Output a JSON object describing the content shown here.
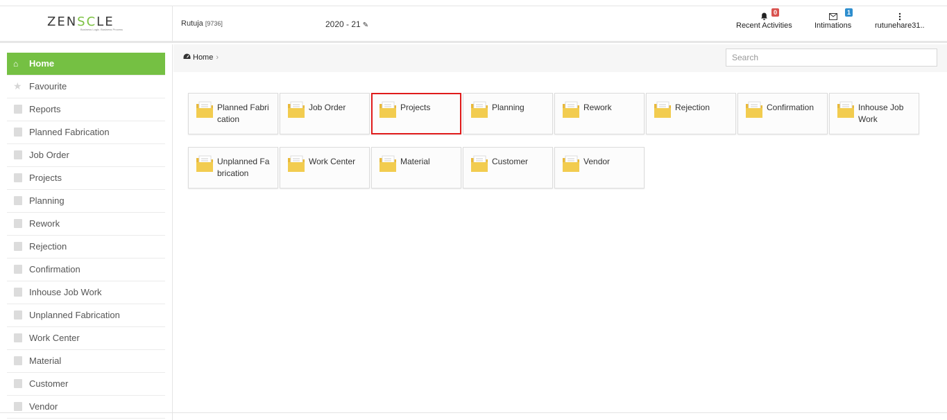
{
  "app": {
    "logo_prefix": "ZEN",
    "logo_highlight": "SC",
    "logo_suffix": "LE",
    "tagline": "Business Logic. Business Process"
  },
  "header": {
    "user_name": "Rutuja",
    "user_id": "[9736]",
    "year": "2020 - 21",
    "recent_activities": {
      "label": "Recent Activities",
      "count": "0"
    },
    "intimations": {
      "label": "Intimations",
      "count": "1"
    },
    "account": {
      "label": "rutunehare31.."
    }
  },
  "sidebar": {
    "items": [
      {
        "label": "Home",
        "icon": "home-icon"
      },
      {
        "label": "Favourite",
        "icon": "star-icon"
      },
      {
        "label": "Reports",
        "icon": "file-icon"
      },
      {
        "label": "Planned Fabrication",
        "icon": "file-icon"
      },
      {
        "label": "Job Order",
        "icon": "file-icon"
      },
      {
        "label": "Projects",
        "icon": "file-icon"
      },
      {
        "label": "Planning",
        "icon": "file-icon"
      },
      {
        "label": "Rework",
        "icon": "file-icon"
      },
      {
        "label": "Rejection",
        "icon": "file-icon"
      },
      {
        "label": "Confirmation",
        "icon": "file-icon"
      },
      {
        "label": "Inhouse Job Work",
        "icon": "file-icon"
      },
      {
        "label": "Unplanned Fabrication",
        "icon": "file-icon"
      },
      {
        "label": "Work Center",
        "icon": "file-icon"
      },
      {
        "label": "Material",
        "icon": "file-icon"
      },
      {
        "label": "Customer",
        "icon": "file-icon"
      },
      {
        "label": "Vendor",
        "icon": "file-icon"
      }
    ]
  },
  "breadcrumb": {
    "home": "Home",
    "separator": "›"
  },
  "search": {
    "placeholder": "Search",
    "value": ""
  },
  "tiles": [
    {
      "label": "Planned Fabri cation"
    },
    {
      "label": "Job Order"
    },
    {
      "label": "Projects"
    },
    {
      "label": "Planning"
    },
    {
      "label": "Rework"
    },
    {
      "label": "Rejection"
    },
    {
      "label": "Confirmation"
    },
    {
      "label": "Inhouse Job Work"
    },
    {
      "label": "Unplanned Fa brication"
    },
    {
      "label": "Work Center"
    },
    {
      "label": "Material"
    },
    {
      "label": "Customer"
    },
    {
      "label": "Vendor"
    }
  ],
  "colors": {
    "accent_green": "#75c043",
    "selected_border": "#e01b1b",
    "folder_yellow": "#f2cc4f",
    "badge_red": "#d9534f",
    "badge_blue": "#2e8ece"
  }
}
